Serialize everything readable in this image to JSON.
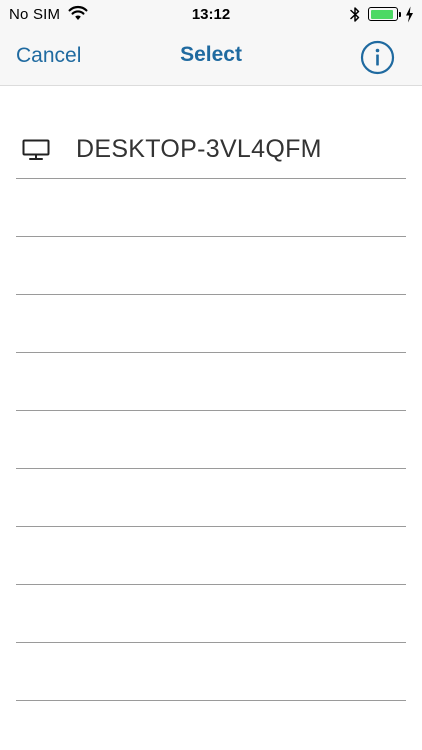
{
  "status_bar": {
    "carrier": "No SIM",
    "time": "13:12",
    "battery_level": 0.9,
    "icons": [
      "wifi-icon",
      "bluetooth-icon",
      "battery-icon",
      "charging-icon"
    ],
    "battery_color": "#4cd964"
  },
  "nav": {
    "cancel_label": "Cancel",
    "title": "Select",
    "info_icon": "info-icon",
    "accent_color": "#1f6aa0"
  },
  "devices": [
    {
      "name": "DESKTOP-3VL4QFM",
      "icon": "desktop-icon"
    }
  ],
  "empty_row_count": 9
}
